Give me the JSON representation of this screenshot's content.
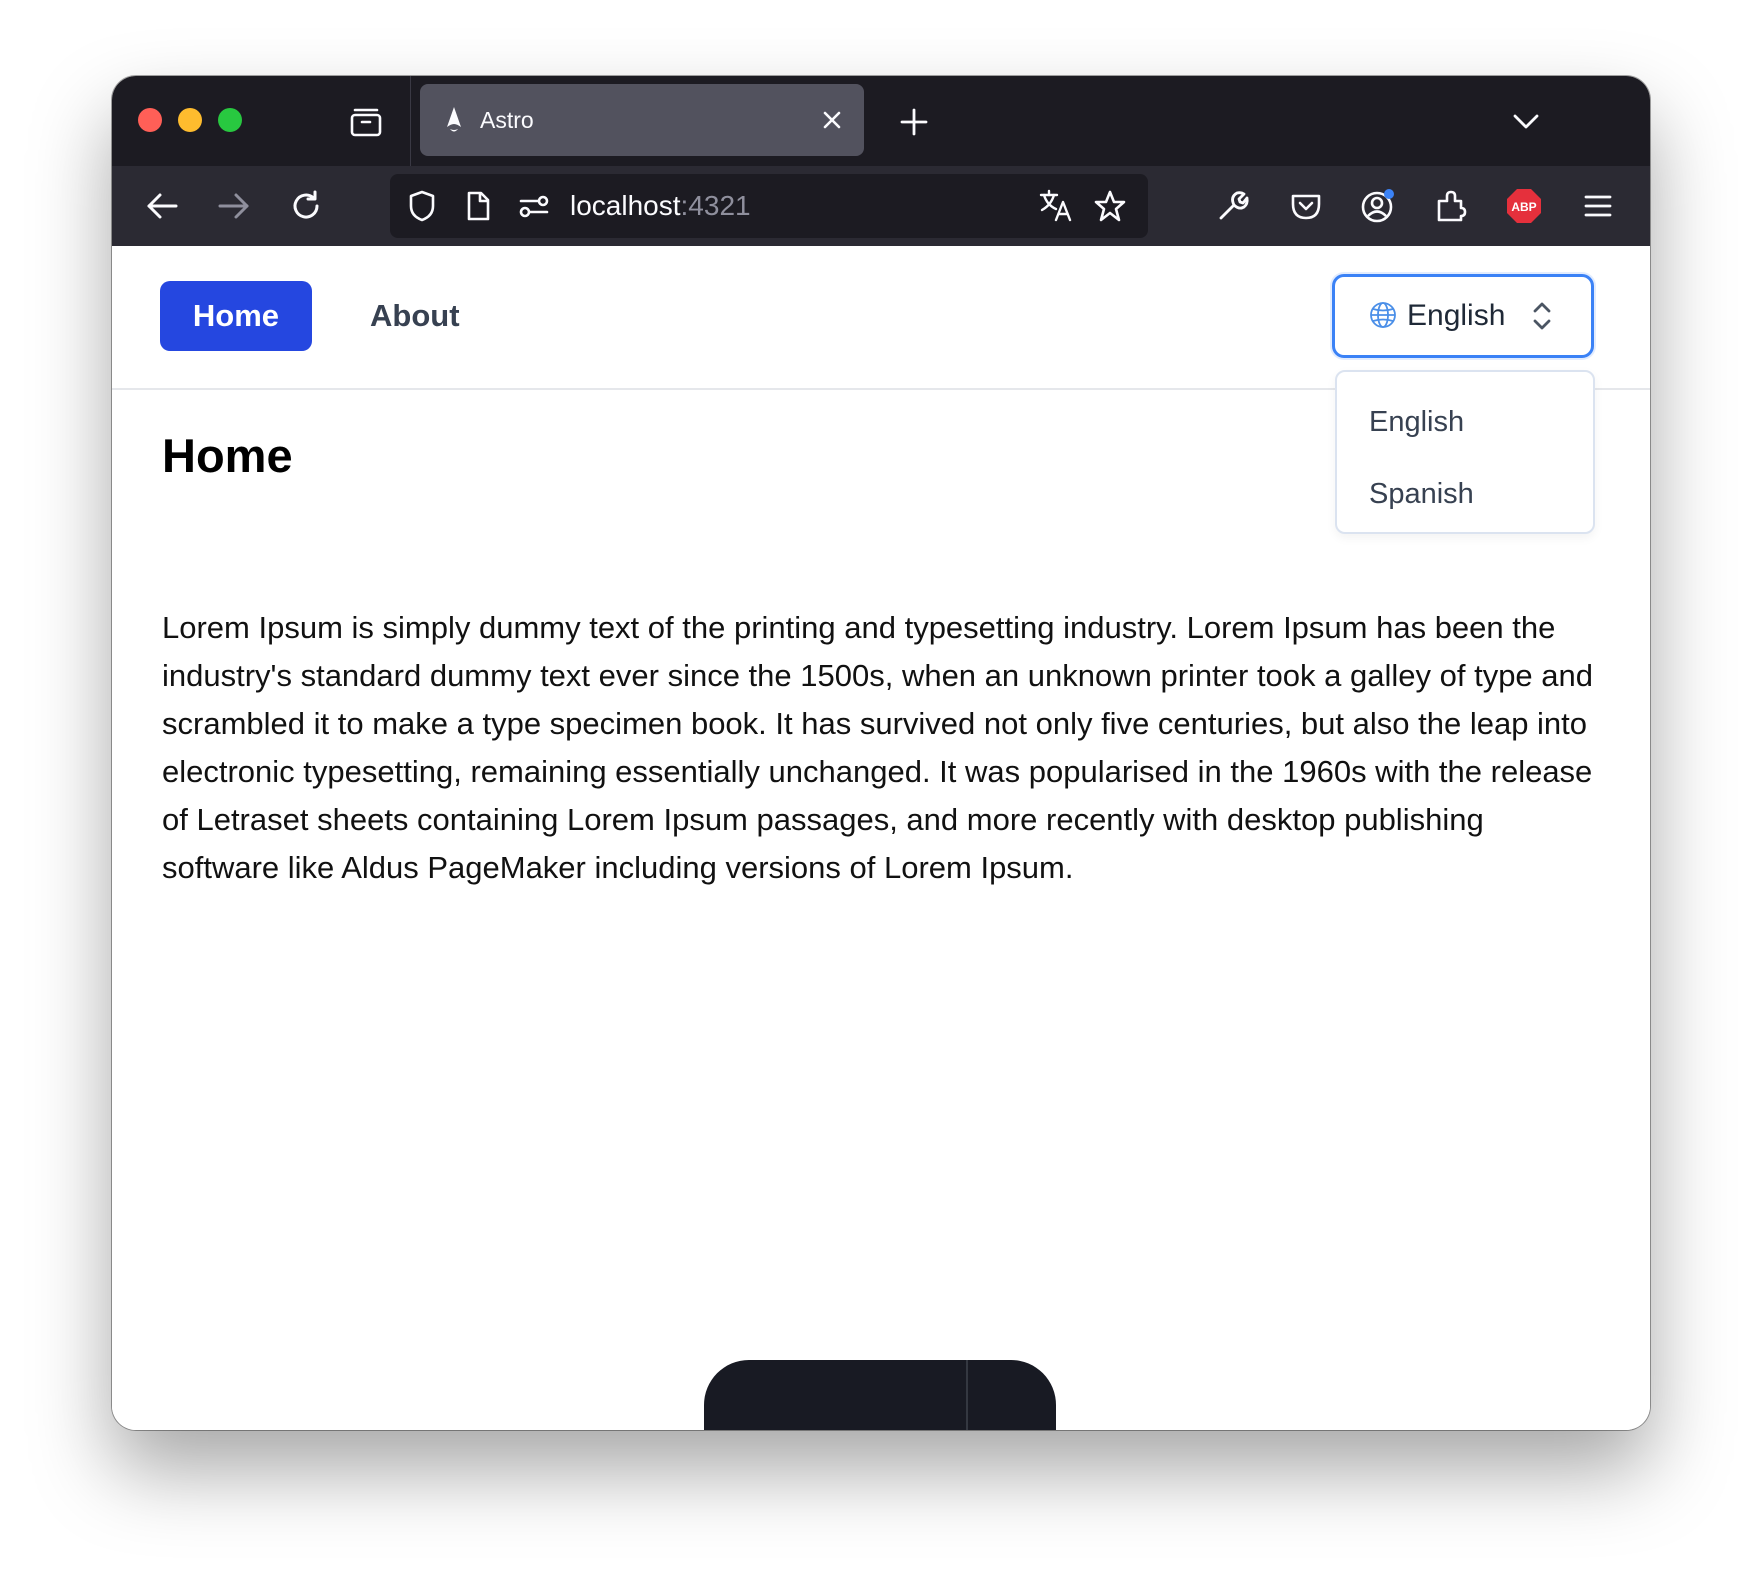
{
  "browser": {
    "tab": {
      "title": "Astro"
    },
    "url": {
      "host": "localhost",
      "port": ":4321"
    },
    "colors": {
      "chrome_dark": "#1c1b22",
      "toolbar": "#2b2a33",
      "tab_active": "#52525e"
    }
  },
  "site": {
    "nav": {
      "home_label": "Home",
      "about_label": "About"
    },
    "language_select": {
      "selected": "English",
      "options": [
        "English",
        "Spanish"
      ]
    },
    "colors": {
      "accent": "#2547e0",
      "focus_ring": "#3b82f6"
    }
  },
  "content": {
    "title": "Home",
    "body": "Lorem Ipsum is simply dummy text of the printing and typesetting industry. Lorem Ipsum has been the industry's standard dummy text ever since the 1500s, when an unknown printer took a galley of type and scrambled it to make a type specimen book. It has survived not only five centuries, but also the leap into electronic typesetting, remaining essentially unchanged. It was popularised in the 1960s with the release of Letraset sheets containing Lorem Ipsum passages, and more recently with desktop publishing software like Aldus PageMaker including versions of Lorem Ipsum."
  }
}
